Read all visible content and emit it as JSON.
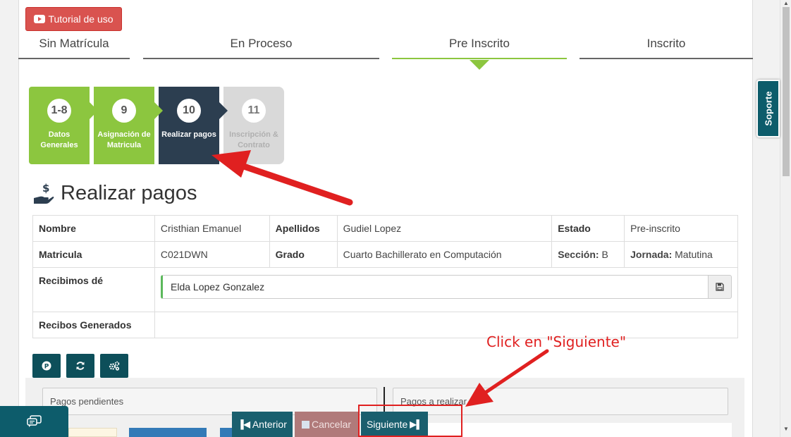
{
  "tutorial": {
    "label": "Tutorial de uso"
  },
  "status_tabs": [
    {
      "label": "Sin Matrícula"
    },
    {
      "label": "En Proceso"
    },
    {
      "label": "Pre Inscrito"
    },
    {
      "label": "Inscrito"
    }
  ],
  "steps": [
    {
      "number": "1-8",
      "label": "Datos Generales"
    },
    {
      "number": "9",
      "label": "Asignación de Matricula"
    },
    {
      "number": "10",
      "label": "Realizar pagos"
    },
    {
      "number": "11",
      "label": "Inscripción & Contrato"
    }
  ],
  "heading": {
    "title": "Realizar pagos"
  },
  "info": {
    "nombre_label": "Nombre",
    "nombre_value": "Cristhian Emanuel",
    "apellidos_label": "Apellidos",
    "apellidos_value": "Gudiel Lopez",
    "estado_label": "Estado",
    "estado_value": "Pre-inscrito",
    "matricula_label": "Matricula",
    "matricula_value": "C021DWN",
    "grado_label": "Grado",
    "grado_value": "Cuarto Bachillerato en Computación",
    "seccion_label": "Sección:",
    "seccion_value": "B",
    "jornada_label": "Jornada:",
    "jornada_value": "Matutina",
    "recibimos_label": "Recibimos dé",
    "recibimos_value": "Elda Lopez Gonzalez",
    "recibos_label": "Recibos Generados"
  },
  "panels": {
    "pendientes": "Pagos pendientes",
    "realizar": "Pagos a realizar"
  },
  "nav": {
    "anterior": "Anterior",
    "cancelar": "Cancelar",
    "siguiente": "Siguiente"
  },
  "soporte": {
    "label": "Soporte"
  },
  "annotation": {
    "text": "Click en \"Siguiente\""
  },
  "colors": {
    "accent_green": "#8cc63f",
    "dark_teal": "#0d4f5a",
    "step_dark": "#2c3e50",
    "annotation_red": "#e02020",
    "danger": "#d9534f"
  },
  "icons": [
    "youtube-icon",
    "money-hand-icon",
    "save-icon",
    "parking-icon",
    "refresh-icon",
    "cogs-icon",
    "chat-icon",
    "step-backward-icon",
    "stop-icon",
    "step-forward-icon"
  ]
}
